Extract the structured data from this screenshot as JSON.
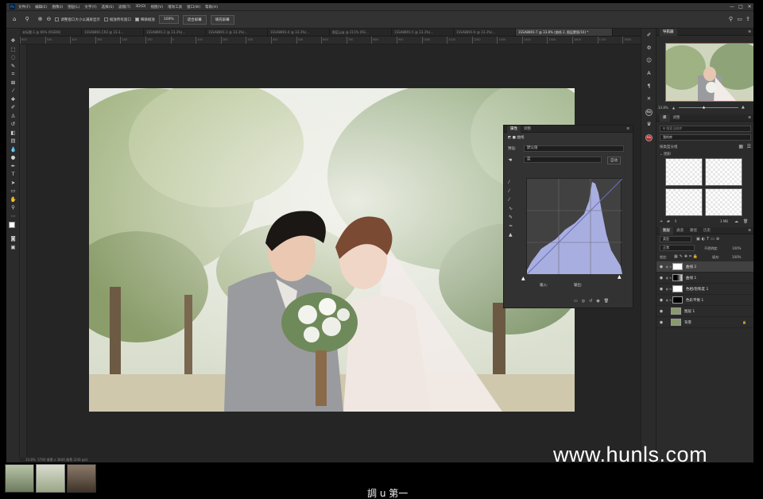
{
  "menu": {
    "logo": "Ps",
    "items": [
      "文件(F)",
      "编辑(E)",
      "图像(I)",
      "图层(L)",
      "文字(Y)",
      "选择(S)",
      "滤镜(T)",
      "3D(D)",
      "视图(V)",
      "增效工具",
      "窗口(W)",
      "帮助(H)"
    ]
  },
  "window_controls": {
    "minimize": "—",
    "maximize": "□",
    "close": "✕"
  },
  "options": {
    "home_icon": "home-icon",
    "zoom_in": "⊕",
    "zoom_out": "⊖",
    "resize_label": "调整窗口大小以满屏显示",
    "zoom_all_label": "缩放所有窗口",
    "scrubby_label": "细微缩放",
    "zoom_value": "100%",
    "fit_button": "适合屏幕",
    "fill_button": "填充屏幕"
  },
  "tabs": [
    {
      "label": "未标题-1 @ 66% (RGB/8)"
    },
    {
      "label": "1SSA8891.CR2 @ 33.3..."
    },
    {
      "label": "1SSA8891-2 @ 33.3%(..."
    },
    {
      "label": "1SSA8891-3 @ 33.3%(..."
    },
    {
      "label": "1SSA8891-4 @ 33.3%(..."
    },
    {
      "label": "图层.jpg @ 211% (RG..."
    },
    {
      "label": "1SSA8891-5 @ 33.3%(..."
    },
    {
      "label": "1SSA8891-6 @ 33.3%(..."
    },
    {
      "label": "1SSA8891-7 @ 33.8% (曲线 2, 图层蒙版/16) *",
      "active": true
    }
  ],
  "ruler_marks": [
    "600",
    "500",
    "400",
    "300",
    "200",
    "100",
    "0",
    "100",
    "200",
    "300",
    "400",
    "500",
    "600",
    "700",
    "800",
    "900",
    "1000",
    "1100",
    "1200",
    "1300",
    "1400",
    "1500",
    "1600",
    "1700",
    "1800"
  ],
  "status": {
    "zoom": "33.8%",
    "info": "5760 像素 x 3840 像素 (240 ppi)"
  },
  "navigator": {
    "tab1": "导航器",
    "zoom": "33.8%"
  },
  "libraries": {
    "tab1": "库",
    "tab2": "调整",
    "search_placeholder": "搜索当前库",
    "library_name": "我的库",
    "group_label": "按类型分组",
    "section": "图形",
    "size": "3 MB"
  },
  "layers_panel": {
    "tabs": [
      "图层",
      "通道",
      "路径",
      "历史"
    ],
    "kind": "类型",
    "blend": "正常",
    "opacity_label": "不透明度:",
    "opacity": "100%",
    "lock_label": "锁定:",
    "fill_label": "填充:",
    "fill": "100%",
    "layers": [
      {
        "name": "曲线 2",
        "selected": true
      },
      {
        "name": "曲线 1"
      },
      {
        "name": "色相/饱和度 1"
      },
      {
        "name": "色彩平衡 1"
      },
      {
        "name": "图层 1"
      },
      {
        "name": "背景",
        "locked": true
      }
    ]
  },
  "properties": {
    "tab1": "属性",
    "tab2": "调整",
    "title": "曲线",
    "preset_label": "预设:",
    "preset_value": "默认值",
    "channel_value": "蓝",
    "auto_button": "自动",
    "input_label": "输入:",
    "output_label": "输出:"
  },
  "subtitle": "調 u 第一",
  "watermark": "www.hunls.com",
  "colors": {
    "curve_fill": "#a9aee1",
    "curve_line": "#6a6fb4",
    "accent": "#31a8ff"
  }
}
